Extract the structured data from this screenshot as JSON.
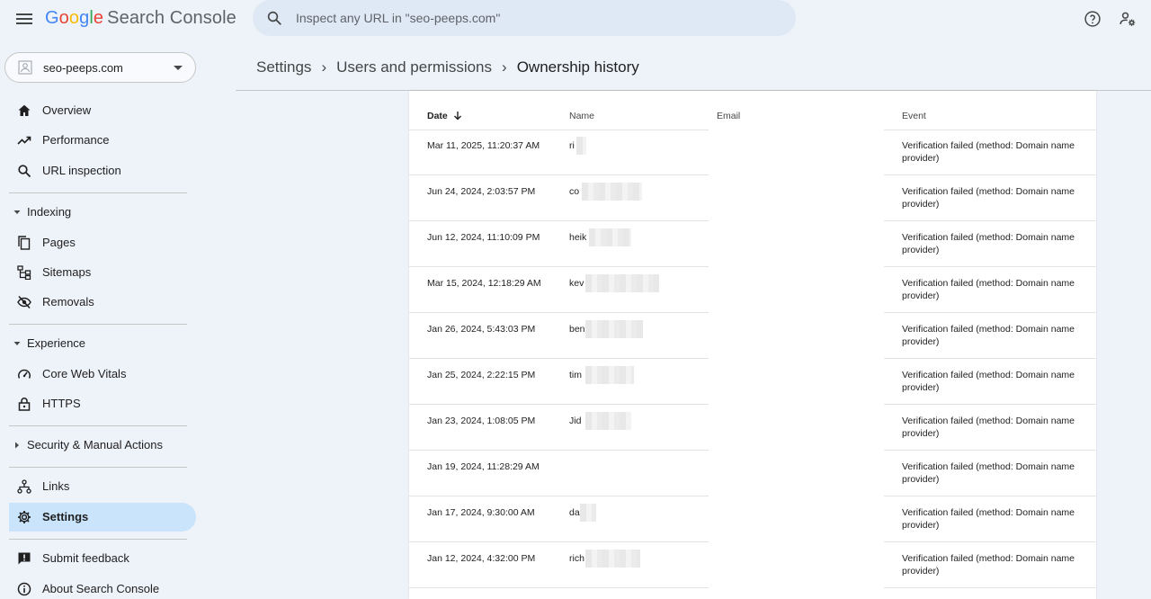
{
  "app": {
    "logo_letters": [
      "G",
      "o",
      "o",
      "g",
      "l",
      "e"
    ],
    "product": "Search Console"
  },
  "search": {
    "placeholder": "Inspect any URL in \"seo-peeps.com\""
  },
  "property": {
    "name": "seo-peeps.com"
  },
  "sidebar": {
    "overview": "Overview",
    "performance": "Performance",
    "url_inspection": "URL inspection",
    "indexing": "Indexing",
    "pages": "Pages",
    "sitemaps": "Sitemaps",
    "removals": "Removals",
    "experience": "Experience",
    "core_web_vitals": "Core Web Vitals",
    "https": "HTTPS",
    "security": "Security & Manual Actions",
    "links": "Links",
    "settings": "Settings",
    "submit_feedback": "Submit feedback",
    "about": "About Search Console"
  },
  "breadcrumb": {
    "settings": "Settings",
    "users": "Users and permissions",
    "current": "Ownership history",
    "separator": "›"
  },
  "table": {
    "headers": {
      "date": "Date",
      "name": "Name",
      "email": "Email",
      "event": "Event"
    },
    "rows": [
      {
        "date": "Mar 11, 2025, 11:20:37 AM",
        "name": "ri",
        "event": "Verification failed (method: Domain name provider)"
      },
      {
        "date": "Jun 24, 2024, 2:03:57 PM",
        "name": "co",
        "event": "Verification failed (method: Domain name provider)"
      },
      {
        "date": "Jun 12, 2024, 11:10:09 PM",
        "name": "heik",
        "event": "Verification failed (method: Domain name provider)"
      },
      {
        "date": "Mar 15, 2024, 12:18:29 AM",
        "name": "kev",
        "event": "Verification failed (method: Domain name provider)"
      },
      {
        "date": "Jan 26, 2024, 5:43:03 PM",
        "name": "ben",
        "event": "Verification failed (method: Domain name provider)"
      },
      {
        "date": "Jan 25, 2024, 2:22:15 PM",
        "name": "tim",
        "event": "Verification failed (method: Domain name provider)"
      },
      {
        "date": "Jan 23, 2024, 1:08:05 PM",
        "name": "Jid",
        "event": "Verification failed (method: Domain name provider)"
      },
      {
        "date": "Jan 19, 2024, 11:28:29 AM",
        "name": "",
        "event": "Verification failed (method: Domain name provider)"
      },
      {
        "date": "Jan 17, 2024, 9:30:00 AM",
        "name": "da",
        "event": "Verification failed (method: Domain name provider)"
      },
      {
        "date": "Jan 12, 2024, 4:32:00 PM",
        "name": "rich",
        "event": "Verification failed (method: Domain name provider)"
      }
    ]
  },
  "colors": {
    "background": "#eef2f9",
    "active_nav": "#c9e4fb",
    "search_bg": "#dfe8f5"
  }
}
